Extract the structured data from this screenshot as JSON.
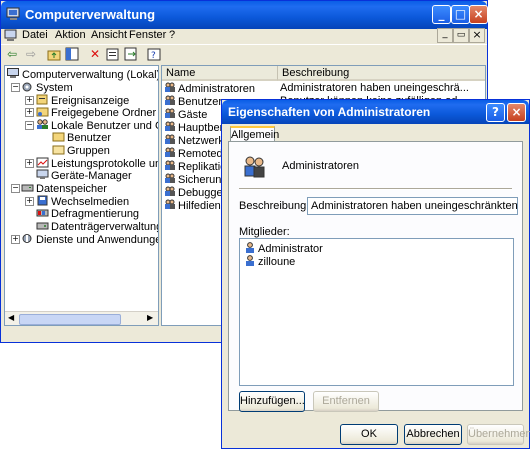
{
  "main": {
    "title": "Computerverwaltung",
    "menu": [
      "Datei",
      "Aktion",
      "Ansicht",
      "Fenster",
      "?"
    ],
    "tree": [
      {
        "label": "Computerverwaltung (Lokal)",
        "icon": "computer-management-icon"
      },
      {
        "label": "System",
        "icon": "system-tools-icon"
      },
      {
        "label": "Ereignisanzeige",
        "icon": "event-viewer-icon"
      },
      {
        "label": "Freigegebene Ordner",
        "icon": "shared-folders-icon"
      },
      {
        "label": "Lokale Benutzer und Gruppen",
        "icon": "local-users-groups-icon"
      },
      {
        "label": "Benutzer",
        "icon": "folder-icon"
      },
      {
        "label": "Gruppen",
        "icon": "folder-open-icon"
      },
      {
        "label": "Leistungsprotokolle und Warnungen",
        "icon": "performance-logs-icon"
      },
      {
        "label": "Geräte-Manager",
        "icon": "device-manager-icon"
      },
      {
        "label": "Datenspeicher",
        "icon": "storage-icon"
      },
      {
        "label": "Wechselmedien",
        "icon": "removable-storage-icon"
      },
      {
        "label": "Defragmentierung",
        "icon": "defragmenter-icon"
      },
      {
        "label": "Datenträgerverwaltung",
        "icon": "disk-management-icon"
      },
      {
        "label": "Dienste und Anwendungen",
        "icon": "services-applications-icon"
      }
    ],
    "columns": [
      "Name",
      "Beschreibung"
    ],
    "groups": [
      {
        "name": "Administratoren",
        "desc": "Administratoren haben uneingeschrä..."
      },
      {
        "name": "Benutzer",
        "desc": "Benutzer können keine zufälligen od..."
      },
      {
        "name": "Gäste",
        "desc": ""
      },
      {
        "name": "Hauptbenutzer",
        "desc": ""
      },
      {
        "name": "Netzwerkkonfigurations-Operatoren",
        "desc": ""
      },
      {
        "name": "Remotedesktopbenutzer",
        "desc": ""
      },
      {
        "name": "Replikations-Operator",
        "desc": ""
      },
      {
        "name": "Sicherungs-Operatoren",
        "desc": ""
      },
      {
        "name": "Debuggerbenutzer",
        "desc": ""
      },
      {
        "name": "Hilfedienstgruppe",
        "desc": ""
      }
    ]
  },
  "dialog": {
    "title": "Eigenschaften von Administratoren",
    "tab": "Allgemein",
    "group_name": "Administratoren",
    "description_label": "Beschreibung:",
    "description_value": "Administratoren haben uneingeschränkten Vollzugriff auf",
    "members_label": "Mitglieder:",
    "members": [
      "Administrator",
      "zilloune"
    ],
    "add_button": "Hinzufügen...",
    "remove_button": "Entfernen",
    "ok_button": "OK",
    "cancel_button": "Abbrechen",
    "apply_button": "Übernehmen"
  }
}
